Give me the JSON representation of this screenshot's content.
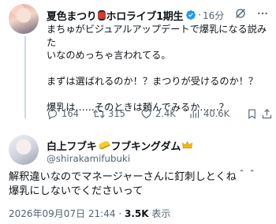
{
  "parent_tweet": {
    "author_name": "夏色まつり",
    "author_name_suffix": "ホロライブ1期生",
    "separator": "·",
    "time_ago": "16分",
    "lines": [
      "まちゅがビジュアルアップデートで爆乳になる説みた",
      "いなのめっちゃ言われてる。",
      "まずは選ばれるのか！？まつりが受けるのか！？",
      "爆乳は……そのときは頼んでみるか……？"
    ],
    "stats": {
      "replies": "164",
      "retweets": "315",
      "likes": "2.4K",
      "views": "40.6K"
    }
  },
  "reply_tweet": {
    "author_name": "白上フブキ",
    "author_name_suffix": "フブキングダム",
    "handle": "@shirakamifubuki",
    "lines": [
      "解釈違いなのでマネージャーさんに釘刺しとくね＾＾",
      "爆乳にしないでくださいって"
    ],
    "timestamp": "2026年09月07日 21:44",
    "separator": "·",
    "view_count": "3.5K",
    "view_label": "表示"
  },
  "colors": {
    "text": "#0f1419",
    "secondary": "#536471",
    "verified": "#1d9bf0",
    "thread_line": "#cfd9de"
  }
}
